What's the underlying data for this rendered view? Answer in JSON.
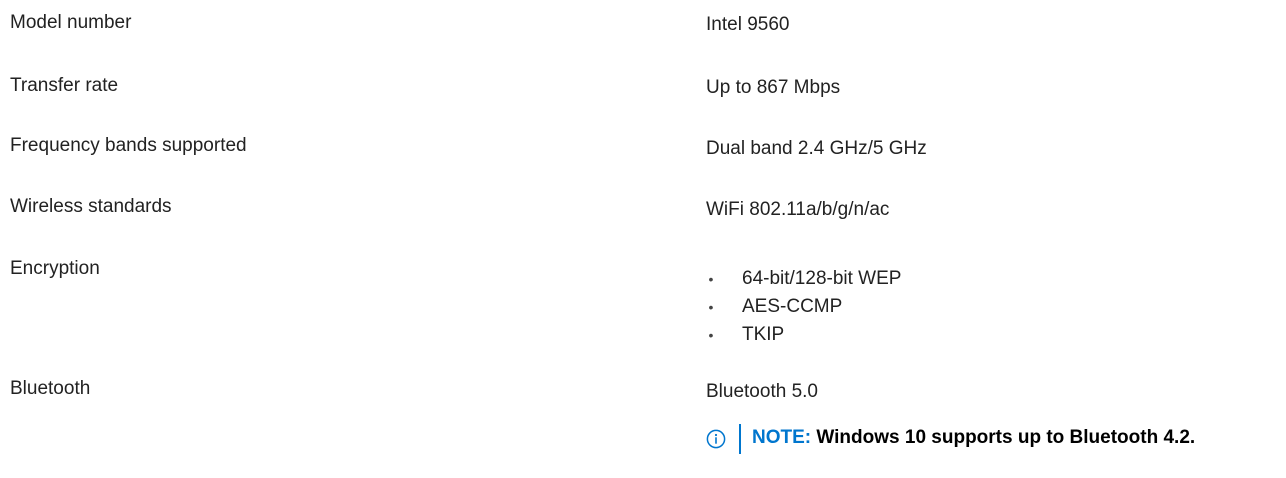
{
  "specs": [
    {
      "label": "Model number",
      "value": "Intel 9560"
    },
    {
      "label": "Transfer rate",
      "value": "Up to 867 Mbps"
    },
    {
      "label": "Frequency bands supported",
      "value": "Dual band 2.4 GHz/5 GHz"
    },
    {
      "label": "Wireless standards",
      "value": "WiFi 802.11a/b/g/n/ac"
    },
    {
      "label": "Encryption",
      "items": [
        "64-bit/128-bit WEP",
        "AES-CCMP",
        "TKIP"
      ]
    },
    {
      "label": "Bluetooth",
      "value": "Bluetooth 5.0"
    }
  ],
  "note": {
    "icon": "info-icon",
    "label": "NOTE:",
    "text": "Windows 10 supports up to Bluetooth 4.2."
  },
  "colors": {
    "accent": "#0076ce",
    "text": "#222222"
  }
}
